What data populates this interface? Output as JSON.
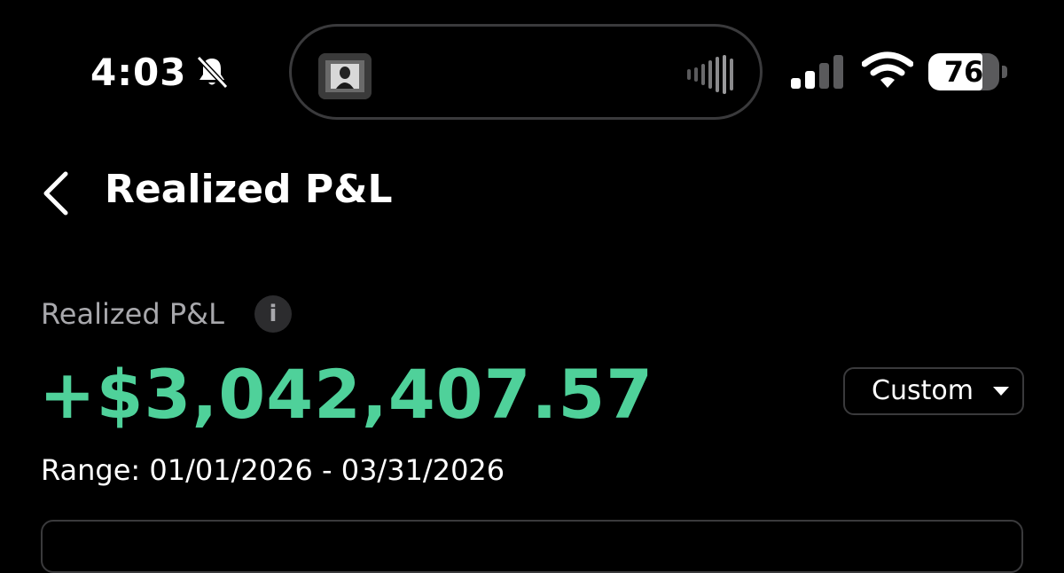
{
  "status_bar": {
    "time": "4:03",
    "silent_icon": "bell-slash-icon",
    "battery_percent": 76,
    "battery_label": "76",
    "signal_bars_active": 2,
    "signal_bars_total": 4
  },
  "nav": {
    "back_icon": "chevron-left-icon",
    "title": "Realized P&L"
  },
  "summary": {
    "label": "Realized P&L",
    "info_glyph": "i",
    "amount": "+$3,042,407.57",
    "amount_color": "#4fd19a",
    "range_selector_value": "Custom",
    "range_text": "Range: 01/01/2026 - 03/31/2026"
  }
}
